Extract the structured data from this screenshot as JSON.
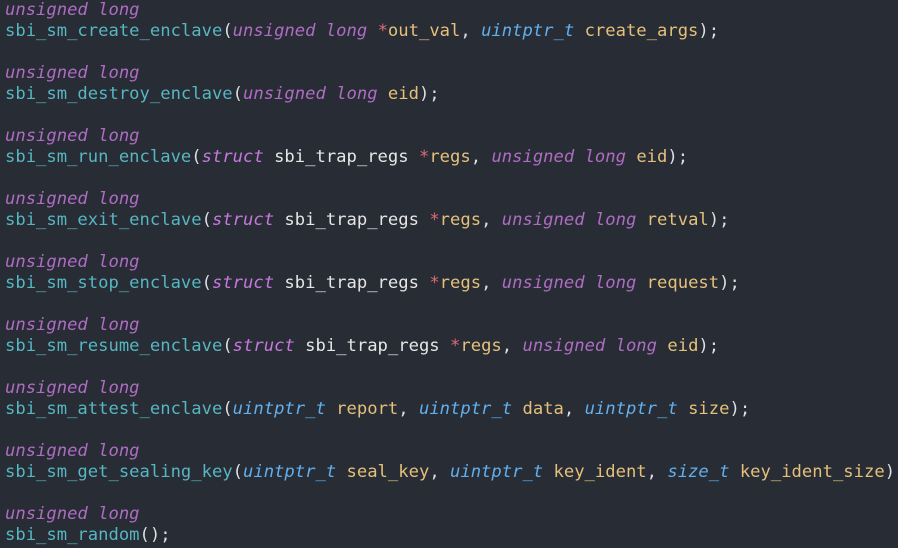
{
  "declarations": [
    {
      "return_type": "unsigned long",
      "name": "sbi_sm_create_enclave",
      "params": [
        {
          "type": "unsigned long",
          "type_kind": "builtin",
          "ptr": "*",
          "name": "out_val"
        },
        {
          "type": "uintptr_t",
          "type_kind": "typedef",
          "ptr": "",
          "name": "create_args"
        }
      ]
    },
    {
      "return_type": "unsigned long",
      "name": "sbi_sm_destroy_enclave",
      "params": [
        {
          "type": "unsigned long",
          "type_kind": "builtin",
          "ptr": "",
          "name": "eid"
        }
      ]
    },
    {
      "return_type": "unsigned long",
      "name": "sbi_sm_run_enclave",
      "params": [
        {
          "type": "struct",
          "type_kind": "struct",
          "struct_name": "sbi_trap_regs",
          "ptr": "*",
          "name": "regs"
        },
        {
          "type": "unsigned long",
          "type_kind": "builtin",
          "ptr": "",
          "name": "eid"
        }
      ]
    },
    {
      "return_type": "unsigned long",
      "name": "sbi_sm_exit_enclave",
      "params": [
        {
          "type": "struct",
          "type_kind": "struct",
          "struct_name": "sbi_trap_regs",
          "ptr": "*",
          "name": "regs"
        },
        {
          "type": "unsigned long",
          "type_kind": "builtin",
          "ptr": "",
          "name": "retval"
        }
      ]
    },
    {
      "return_type": "unsigned long",
      "name": "sbi_sm_stop_enclave",
      "params": [
        {
          "type": "struct",
          "type_kind": "struct",
          "struct_name": "sbi_trap_regs",
          "ptr": "*",
          "name": "regs"
        },
        {
          "type": "unsigned long",
          "type_kind": "builtin",
          "ptr": "",
          "name": "request"
        }
      ]
    },
    {
      "return_type": "unsigned long",
      "name": "sbi_sm_resume_enclave",
      "params": [
        {
          "type": "struct",
          "type_kind": "struct",
          "struct_name": "sbi_trap_regs",
          "ptr": "*",
          "name": "regs"
        },
        {
          "type": "unsigned long",
          "type_kind": "builtin",
          "ptr": "",
          "name": "eid"
        }
      ]
    },
    {
      "return_type": "unsigned long",
      "name": "sbi_sm_attest_enclave",
      "params": [
        {
          "type": "uintptr_t",
          "type_kind": "typedef",
          "ptr": "",
          "name": "report"
        },
        {
          "type": "uintptr_t",
          "type_kind": "typedef",
          "ptr": "",
          "name": "data"
        },
        {
          "type": "uintptr_t",
          "type_kind": "typedef",
          "ptr": "",
          "name": "size"
        }
      ]
    },
    {
      "return_type": "unsigned long",
      "name": "sbi_sm_get_sealing_key",
      "params": [
        {
          "type": "uintptr_t",
          "type_kind": "typedef",
          "ptr": "",
          "name": "seal_key"
        },
        {
          "type": "uintptr_t",
          "type_kind": "typedef",
          "ptr": "",
          "name": "key_ident"
        },
        {
          "type": "size_t",
          "type_kind": "typedef",
          "ptr": "",
          "name": "key_ident_size"
        }
      ]
    },
    {
      "return_type": "unsigned long",
      "name": "sbi_sm_random",
      "params": []
    }
  ],
  "theme": {
    "background": "#282c34",
    "function_color": "#56b6c2",
    "builtin_type_color": "#c678dd",
    "typedef_color": "#61afef",
    "param_color": "#e5c07b",
    "pointer_color": "#e06c75"
  }
}
